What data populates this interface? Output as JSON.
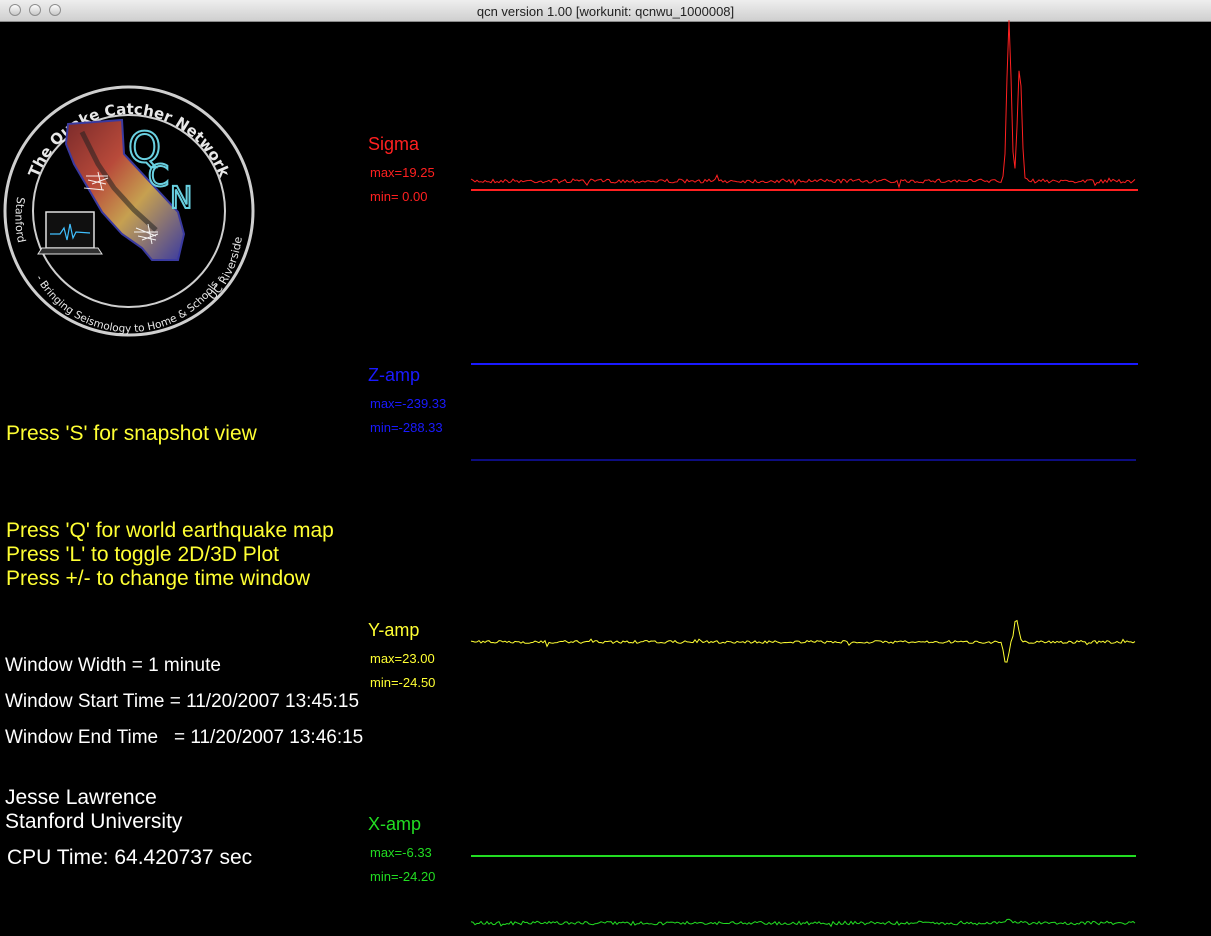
{
  "window": {
    "title": "qcn version 1.00 [workunit: qcnwu_1000008]",
    "buttons": [
      "close",
      "minimize",
      "zoom"
    ]
  },
  "logo": {
    "ring_text_top": "The Quake Catcher Network",
    "ring_text_left": "Stanford",
    "ring_text_bottom": "- Bringing Seismology to Home & Schools -",
    "ring_text_right": "UC Riverside",
    "badge": "QCN"
  },
  "instructions": {
    "snapshot": "Press 'S' for snapshot view",
    "quake_map": "Press 'Q' for world earthquake map",
    "toggle_plot": "Press 'L' to toggle 2D/3D Plot",
    "time_window": "Press +/- to change time window"
  },
  "info": {
    "window_width": "Window Width = 1 minute",
    "window_start": "Window Start Time = 11/20/2007 13:45:15",
    "window_end": "Window End Time   = 11/20/2007 13:46:15",
    "author_name": "Jesse Lawrence",
    "author_org": "Stanford University",
    "cpu_time": "CPU Time: 64.420737 sec"
  },
  "colors": {
    "sigma": "#ff2020",
    "z_amp": "#1a1aff",
    "y_amp": "#ffff33",
    "x_amp": "#22dd22",
    "instructions": "#ffff33",
    "info": "#ffffff"
  },
  "chart_data": {
    "type": "line",
    "x": {
      "start": "11/20/2007 13:45:15",
      "end": "11/20/2007 13:46:15"
    },
    "series": [
      {
        "name": "Sigma",
        "key": "sigma",
        "max_label": "max=19.25",
        "min_label": "min= 0.00",
        "max": 19.25,
        "min": 0.0,
        "events": [
          {
            "t": 0.809,
            "amp": 1.0
          },
          {
            "t": 0.825,
            "amp": 0.72
          }
        ]
      },
      {
        "name": "Z-amp",
        "key": "z_amp",
        "max_label": "max=-239.33",
        "min_label": "min=-288.33",
        "max": -239.33,
        "min": -288.33,
        "events": []
      },
      {
        "name": "Y-amp",
        "key": "y_amp",
        "max_label": "max=23.00",
        "min_label": "min=-24.50",
        "max": 23.0,
        "min": -24.5,
        "events": [
          {
            "t": 0.805,
            "amp": -0.9
          },
          {
            "t": 0.82,
            "amp": 0.9
          }
        ]
      },
      {
        "name": "X-amp",
        "key": "x_amp",
        "max_label": "max=-6.33",
        "min_label": "min=-24.20",
        "max": -6.33,
        "min": -24.2,
        "events": [
          {
            "t": 0.81,
            "amp": 0.5
          }
        ]
      }
    ]
  }
}
